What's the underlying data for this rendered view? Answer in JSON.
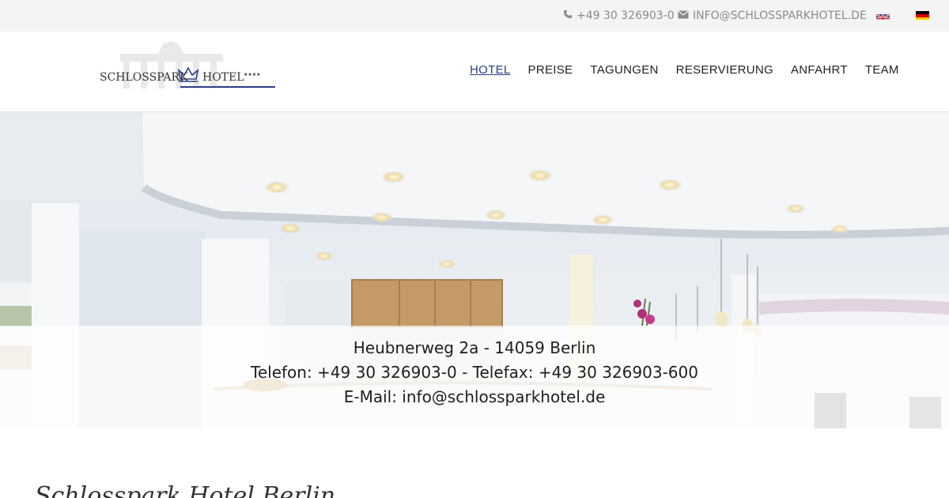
{
  "topbar": {
    "phone_icon": "phone-icon",
    "phone": "+49 30 326903-0",
    "email_icon": "envelope-icon",
    "email": "INFO@SCHLOSSPARKHOTEL.DE",
    "languages": [
      "english-flag-icon",
      "german-flag-icon"
    ]
  },
  "header": {
    "logo_text_left": "SCHLOSSPARK",
    "logo_text_right": "HOTEL",
    "logo_stars": "★★★★",
    "nav": [
      {
        "label": "HOTEL",
        "active": true
      },
      {
        "label": "PREISE",
        "active": false
      },
      {
        "label": "TAGUNGEN",
        "active": false
      },
      {
        "label": "RESERVIERUNG",
        "active": false
      },
      {
        "label": "ANFAHRT",
        "active": false
      },
      {
        "label": "TEAM",
        "active": false
      }
    ],
    "active_color": "#2a3e86"
  },
  "hero": {
    "address": "Heubnerweg 2a - 14059 Berlin",
    "phone_fax": "Telefon: +49 30 326903-0 - Telefax: +49 30 326903-600",
    "email": "E-Mail: info@schlossparkhotel.de"
  },
  "main": {
    "title": "Schlosspark Hotel Berlin"
  }
}
